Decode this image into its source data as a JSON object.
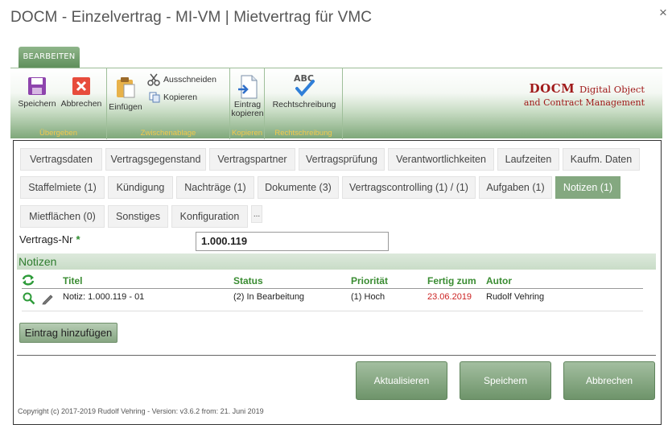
{
  "dialog": {
    "title": "DOCM - Einzelvertrag - MI-VM | Mietvertrag für VMC",
    "close_glyph": "×"
  },
  "ribbon": {
    "tab_label": "BEARBEITEN",
    "groups": {
      "uebergeben": "Übergeben",
      "zwischenablage": "Zwischenablage",
      "kopieren": "Kopieren",
      "rechtschreibung": "Rechtschreibung"
    },
    "buttons": {
      "speichern": "Speichern",
      "abbrechen": "Abbrechen",
      "einfuegen": "Einfügen",
      "ausschneiden": "Ausschneiden",
      "kopieren": "Kopieren",
      "eintrag_kopieren_1": "Eintrag",
      "eintrag_kopieren_2": "kopieren",
      "rechtschreibung": "Rechtschreibung",
      "abc": "ABC"
    },
    "brand": {
      "name": "DOCM",
      "tagline": "Digital Object",
      "line2": "and Contract Management"
    }
  },
  "tabs": {
    "row1": [
      "Vertragsdaten",
      "Vertragsgegenstand",
      "Vertragspartner",
      "Vertragsprüfung",
      "Verantwortlichkeiten",
      "Laufzeiten",
      "Kaufm. Daten"
    ],
    "row2": [
      "Staffelmiete (1)",
      "Kündigung",
      "Nachträge (1)",
      "Dokumente (3)",
      "Vertragscontrolling (1) / (1)",
      "Aufgaben (1)",
      "Notizen (1)"
    ],
    "row3": [
      "Mietflächen (0)",
      "Sonstiges",
      "Konfiguration",
      "..."
    ],
    "active": "Notizen (1)"
  },
  "form": {
    "vertrags_nr_label": "Vertrags-Nr",
    "required_mark": "*",
    "vertrags_nr_value": "1.000.119"
  },
  "notizen": {
    "section_title": "Notizen",
    "columns": {
      "titel": "Titel",
      "status": "Status",
      "prioritaet": "Priorität",
      "fertig_zum": "Fertig zum",
      "autor": "Autor"
    },
    "rows": [
      {
        "titel": "Notiz: 1.000.119 - 01",
        "status": "(2) In Bearbeitung",
        "prioritaet": "(1) Hoch",
        "fertig_zum": "23.06.2019",
        "autor": "Rudolf Vehring"
      }
    ],
    "add_button": "Eintrag hinzufügen"
  },
  "actions": {
    "aktualisieren": "Aktualisieren",
    "speichern": "Speichern",
    "abbrechen": "Abbrechen"
  },
  "footer": {
    "copyright": "Copyright (c) 2017-2019 Rudolf Vehring - Version: v3.6.2 from: 21. Juni 2019"
  },
  "colors": {
    "accent_green": "#84a880",
    "brand_red": "#a01a1a",
    "group_label_yellow": "#f2c94c",
    "date_red": "#cc2222"
  },
  "icons": {
    "save": "floppy-disk-icon",
    "cancel": "close-square-icon",
    "paste": "clipboard-icon",
    "cut": "scissors-icon",
    "copy": "copy-icon",
    "copy_entry": "document-copy-icon",
    "spellcheck": "abc-check-icon",
    "refresh": "refresh-icon",
    "view": "magnifier-icon",
    "edit": "pencil-icon"
  }
}
